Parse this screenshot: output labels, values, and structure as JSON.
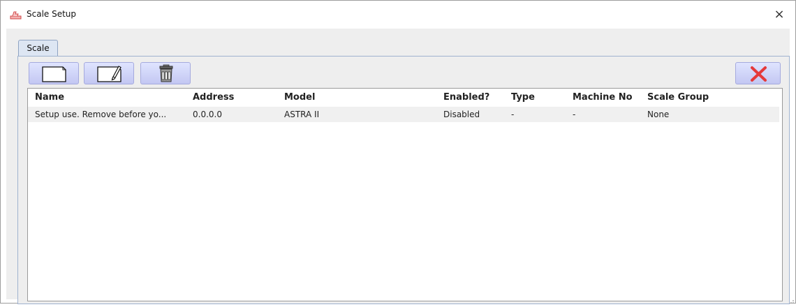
{
  "window": {
    "title": "Scale Setup",
    "close_glyph": "×"
  },
  "tabs": [
    {
      "label": "Scale"
    }
  ],
  "toolbar": {
    "buttons": [
      {
        "name": "new-button",
        "icon": "new-document-icon"
      },
      {
        "name": "edit-button",
        "icon": "edit-document-icon"
      },
      {
        "name": "delete-button",
        "icon": "trash-icon"
      },
      {
        "name": "close-panel-button",
        "icon": "red-x-icon"
      }
    ]
  },
  "table": {
    "columns": [
      "Name",
      "Address",
      "Model",
      "Enabled?",
      "Type",
      "Machine No",
      "Scale Group"
    ],
    "rows": [
      [
        "Setup use. Remove before yo...",
        "0.0.0.0",
        "ASTRA II",
        "Disabled",
        "-",
        "-",
        "None"
      ]
    ]
  },
  "colors": {
    "button_gradient_top": "#dfe4ff",
    "button_gradient_bottom": "#c3c7f2",
    "delete_x": "#e53a3a",
    "row_background": "#f0f0f0"
  }
}
